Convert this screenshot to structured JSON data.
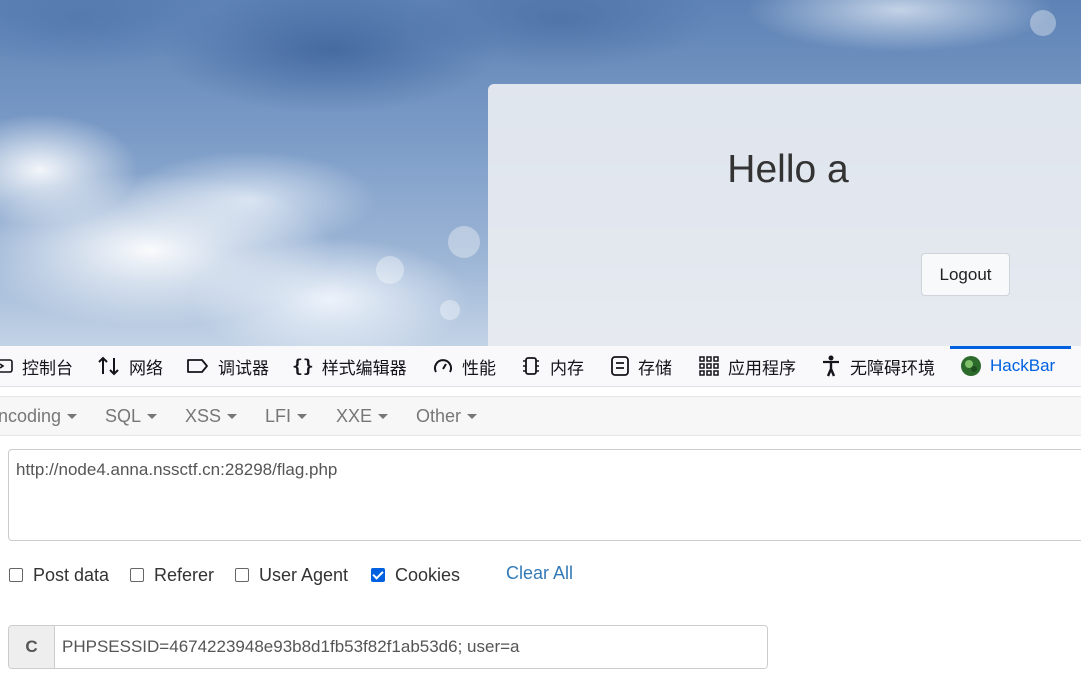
{
  "page": {
    "greeting": "Hello a",
    "logout_label": "Logout"
  },
  "devtools": {
    "tabs": [
      {
        "label": "控制台",
        "icon": "console-icon"
      },
      {
        "label": "网络",
        "icon": "network-arrows-icon"
      },
      {
        "label": "调试器",
        "icon": "debugger-tag-icon"
      },
      {
        "label": "样式编辑器",
        "icon": "braces-icon"
      },
      {
        "label": "性能",
        "icon": "gauge-icon"
      },
      {
        "label": "内存",
        "icon": "memory-chip-icon"
      },
      {
        "label": "存储",
        "icon": "storage-icon"
      },
      {
        "label": "应用程序",
        "icon": "grid-icon"
      },
      {
        "label": "无障碍环境",
        "icon": "accessibility-icon"
      },
      {
        "label": "HackBar",
        "icon": "hackbar-logo-icon",
        "active": true
      }
    ]
  },
  "hackbar": {
    "menu": [
      "ncoding",
      "SQL",
      "XSS",
      "LFI",
      "XXE",
      "Other"
    ],
    "url": "http://node4.anna.nssctf.cn:28298/flag.php",
    "options": [
      {
        "label": "Post data",
        "checked": false
      },
      {
        "label": "Referer",
        "checked": false
      },
      {
        "label": "User Agent",
        "checked": false
      },
      {
        "label": "Cookies",
        "checked": true
      }
    ],
    "clear_all": "Clear All",
    "cookie_prefix": "C",
    "cookie_value": "PHPSESSID=4674223948e93b8d1fb53f82f1ab53d6; user=a"
  },
  "colors": {
    "active_tab": "#0061e0",
    "link": "#337ab7",
    "checkbox_checked": "#0060df"
  }
}
